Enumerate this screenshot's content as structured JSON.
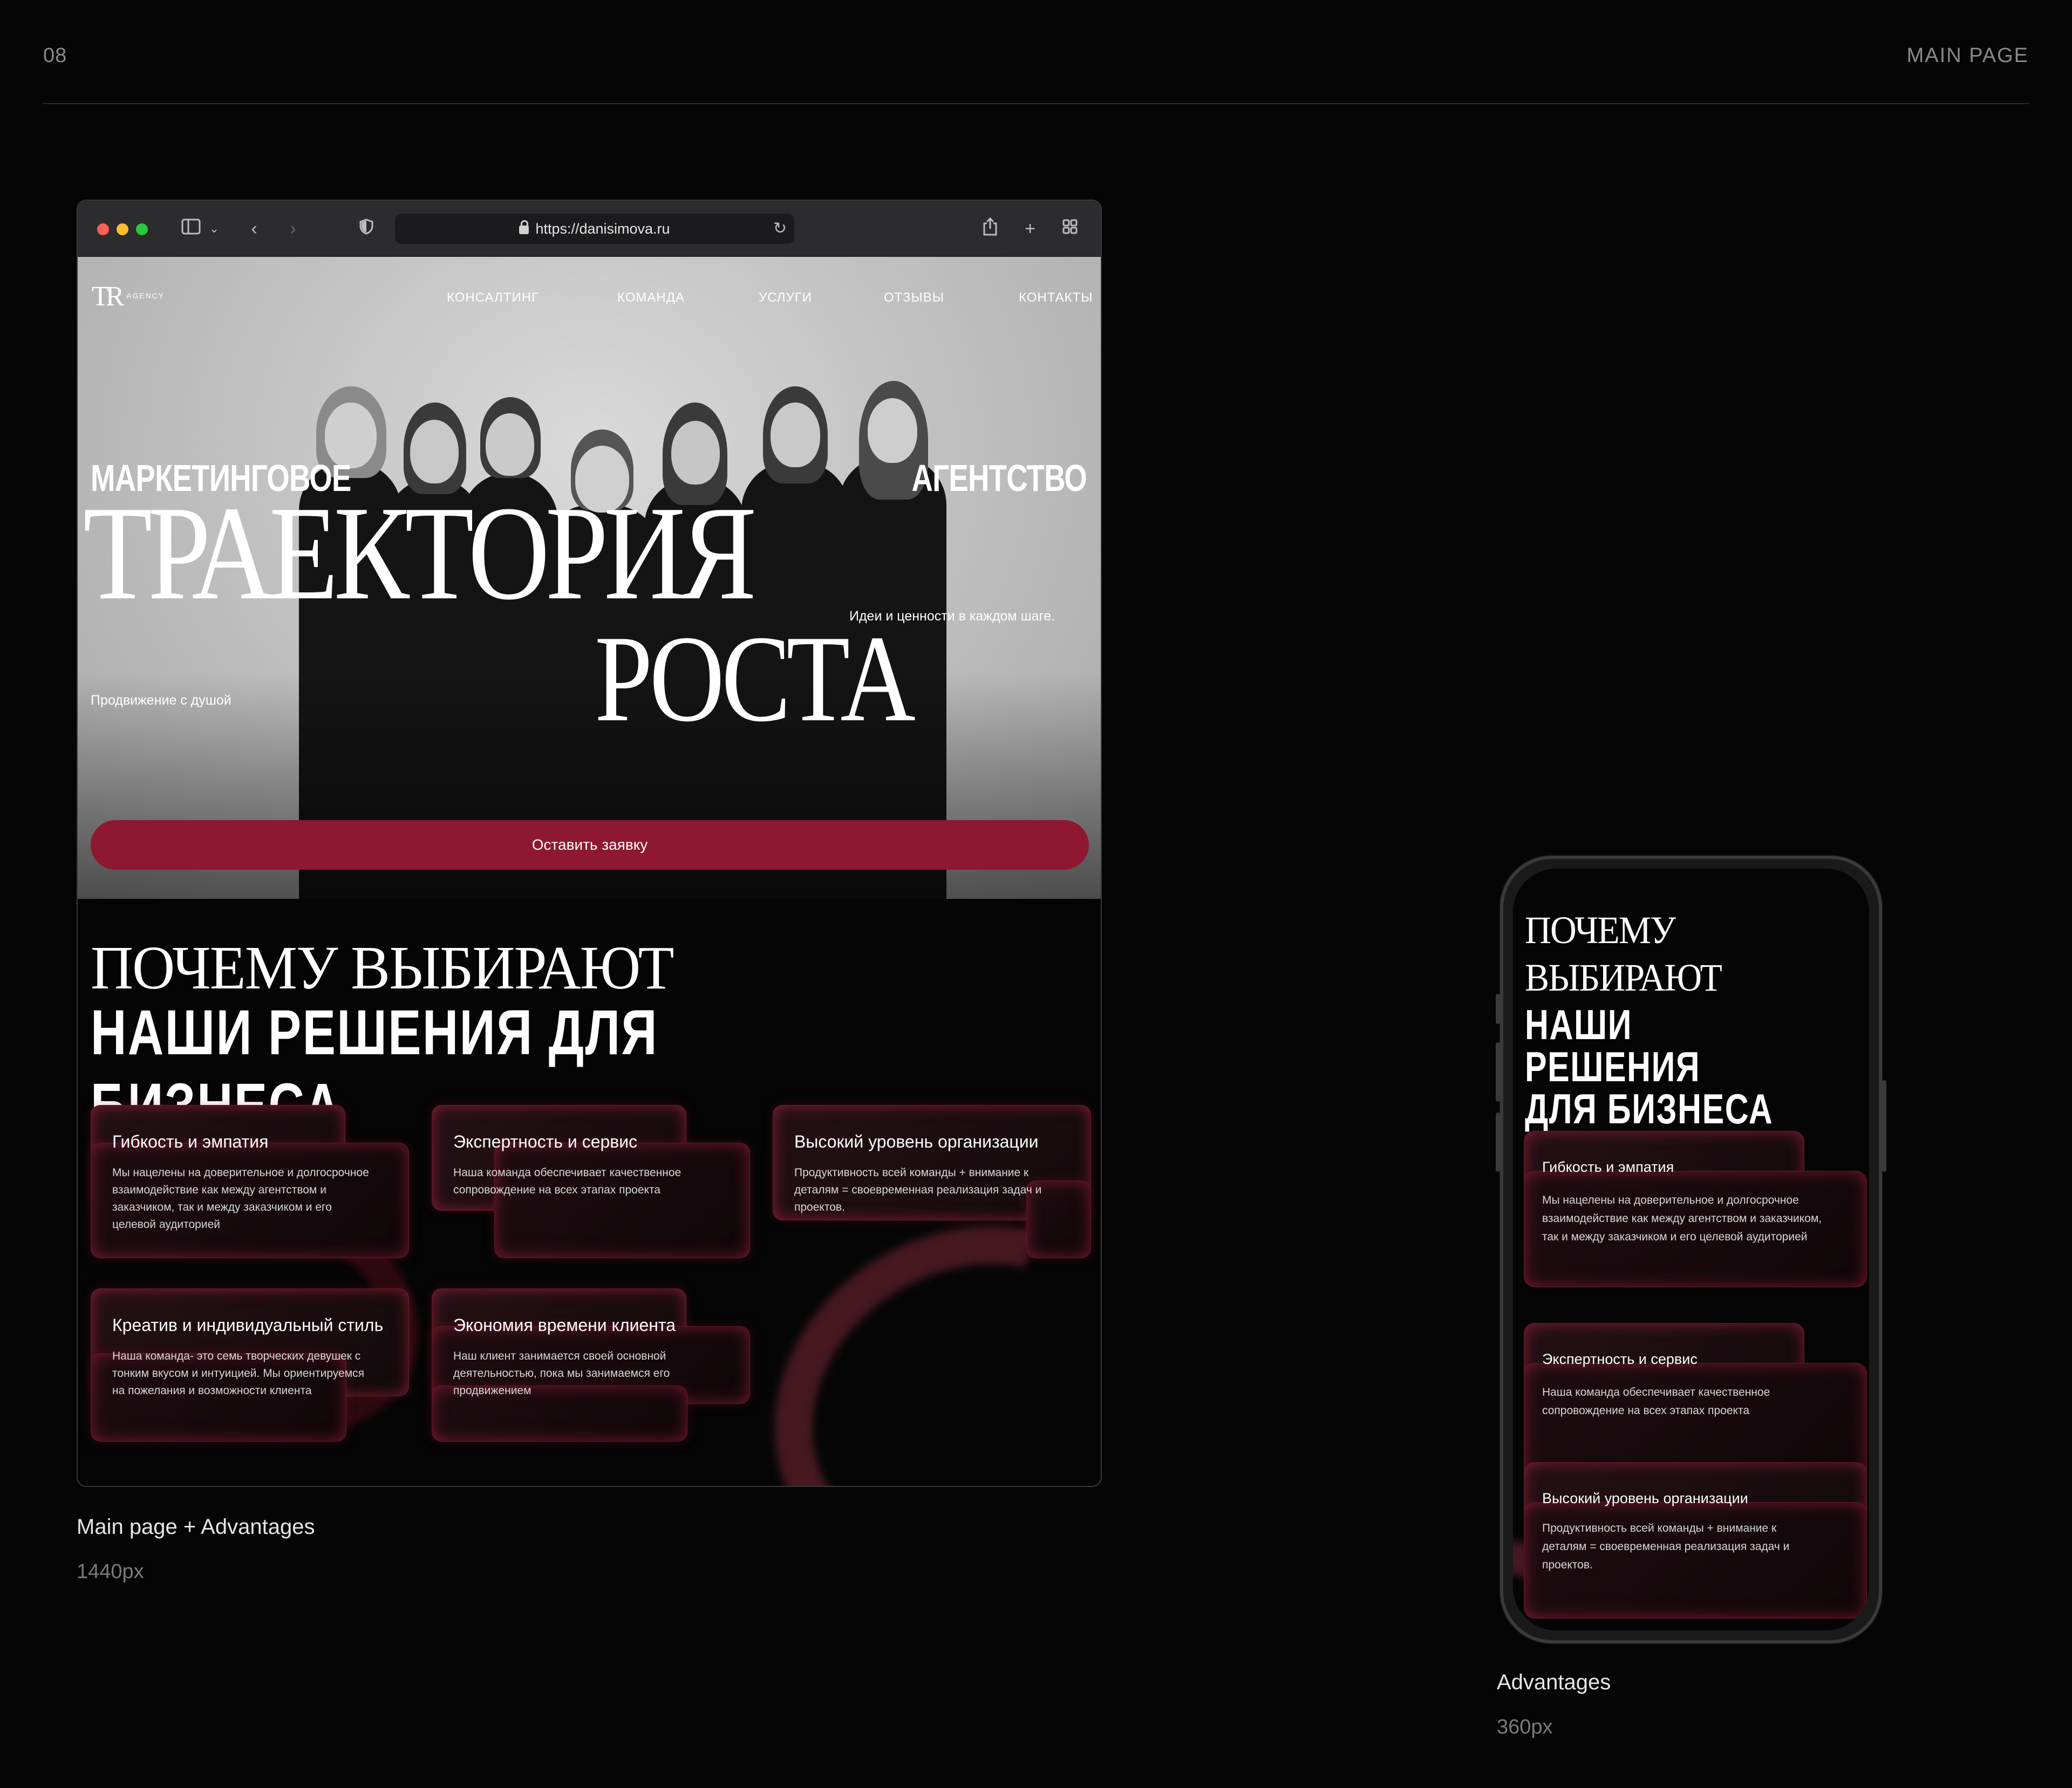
{
  "header": {
    "page_number": "08",
    "page_title": "MAIN PAGE"
  },
  "browser": {
    "url": "https://danisimova.ru",
    "hero": {
      "logo_mark": "TR",
      "logo_sub": "AGENCY",
      "nav": [
        "КОНСАЛТИНГ",
        "КОМАНДА",
        "УСЛУГИ",
        "ОТЗЫВЫ",
        "КОНТАКТЫ"
      ],
      "word_left": "МАРКЕТИНГОВОЕ",
      "word_right": "АГЕНТСТВО",
      "display_1": "ТРАЕКТОРИЯ",
      "display_2": "РОСТА",
      "tagline_right": "Идеи и ценности в каждом шаге.",
      "tagline_left": "Продвижение с душой",
      "cta": "Оставить заявку"
    },
    "advantages": {
      "title_1": "ПОЧЕМУ ВЫБИРАЮТ",
      "title_2": "НАШИ РЕШЕНИЯ ДЛЯ БИЗНЕСА",
      "cards": [
        {
          "title": "Гибкость и эмпатия",
          "text": "Мы нацелены на доверительное и долгосрочное взаимодействие как между агентством и заказчиком, так и между заказчиком и его целевой аудиторией"
        },
        {
          "title": "Экспертность и сервис",
          "text": "Наша команда обеспечивает качественное сопровождение на всех этапах проекта"
        },
        {
          "title": "Высокий уровень организации",
          "text": "Продуктивность всей команды + внимание к деталям = своевременная реализация задач и проектов."
        },
        {
          "title": "Креатив и индивидуальный стиль",
          "text": "Наша команда- это семь творческих девушек с тонким вкусом и интуицией. Мы ориентируемся на пожелания и возможности клиента"
        },
        {
          "title": "Экономия времени клиента",
          "text": "Наш клиент занимается своей основной деятельностью, пока мы занимаемся его продвижением"
        }
      ]
    }
  },
  "captions": {
    "desktop_title": "Main page + Advantages",
    "desktop_size": "1440px",
    "mobile_title": "Advantages",
    "mobile_size": "360px"
  },
  "phone": {
    "title_1a": "ПОЧЕМУ",
    "title_1b": "ВЫБИРАЮТ",
    "title_2a": "НАШИ РЕШЕНИЯ",
    "title_2b": "ДЛЯ БИЗНЕСА",
    "cards": [
      {
        "title": "Гибкость и эмпатия",
        "text": "Мы нацелены на доверительное и долгосрочное взаимодействие как между агентством и заказчиком, так и между заказчиком и его целевой аудиторией"
      },
      {
        "title": "Экспертность и сервис",
        "text": "Наша команда обеспечивает качественное сопровождение на всех этапах проекта"
      },
      {
        "title": "Высокий уровень организации",
        "text": "Продуктивность всей команды + внимание к деталям = своевременная реализация задач и проектов."
      }
    ]
  },
  "colors": {
    "accent": "#8d1830",
    "card_glow": "#d62850",
    "background": "#050505"
  },
  "icons": [
    "sidebar-icon",
    "chevron-down-icon",
    "back-icon",
    "forward-icon",
    "shield-icon",
    "lock-icon",
    "reload-icon",
    "share-icon",
    "new-tab-icon",
    "tab-overview-icon"
  ]
}
